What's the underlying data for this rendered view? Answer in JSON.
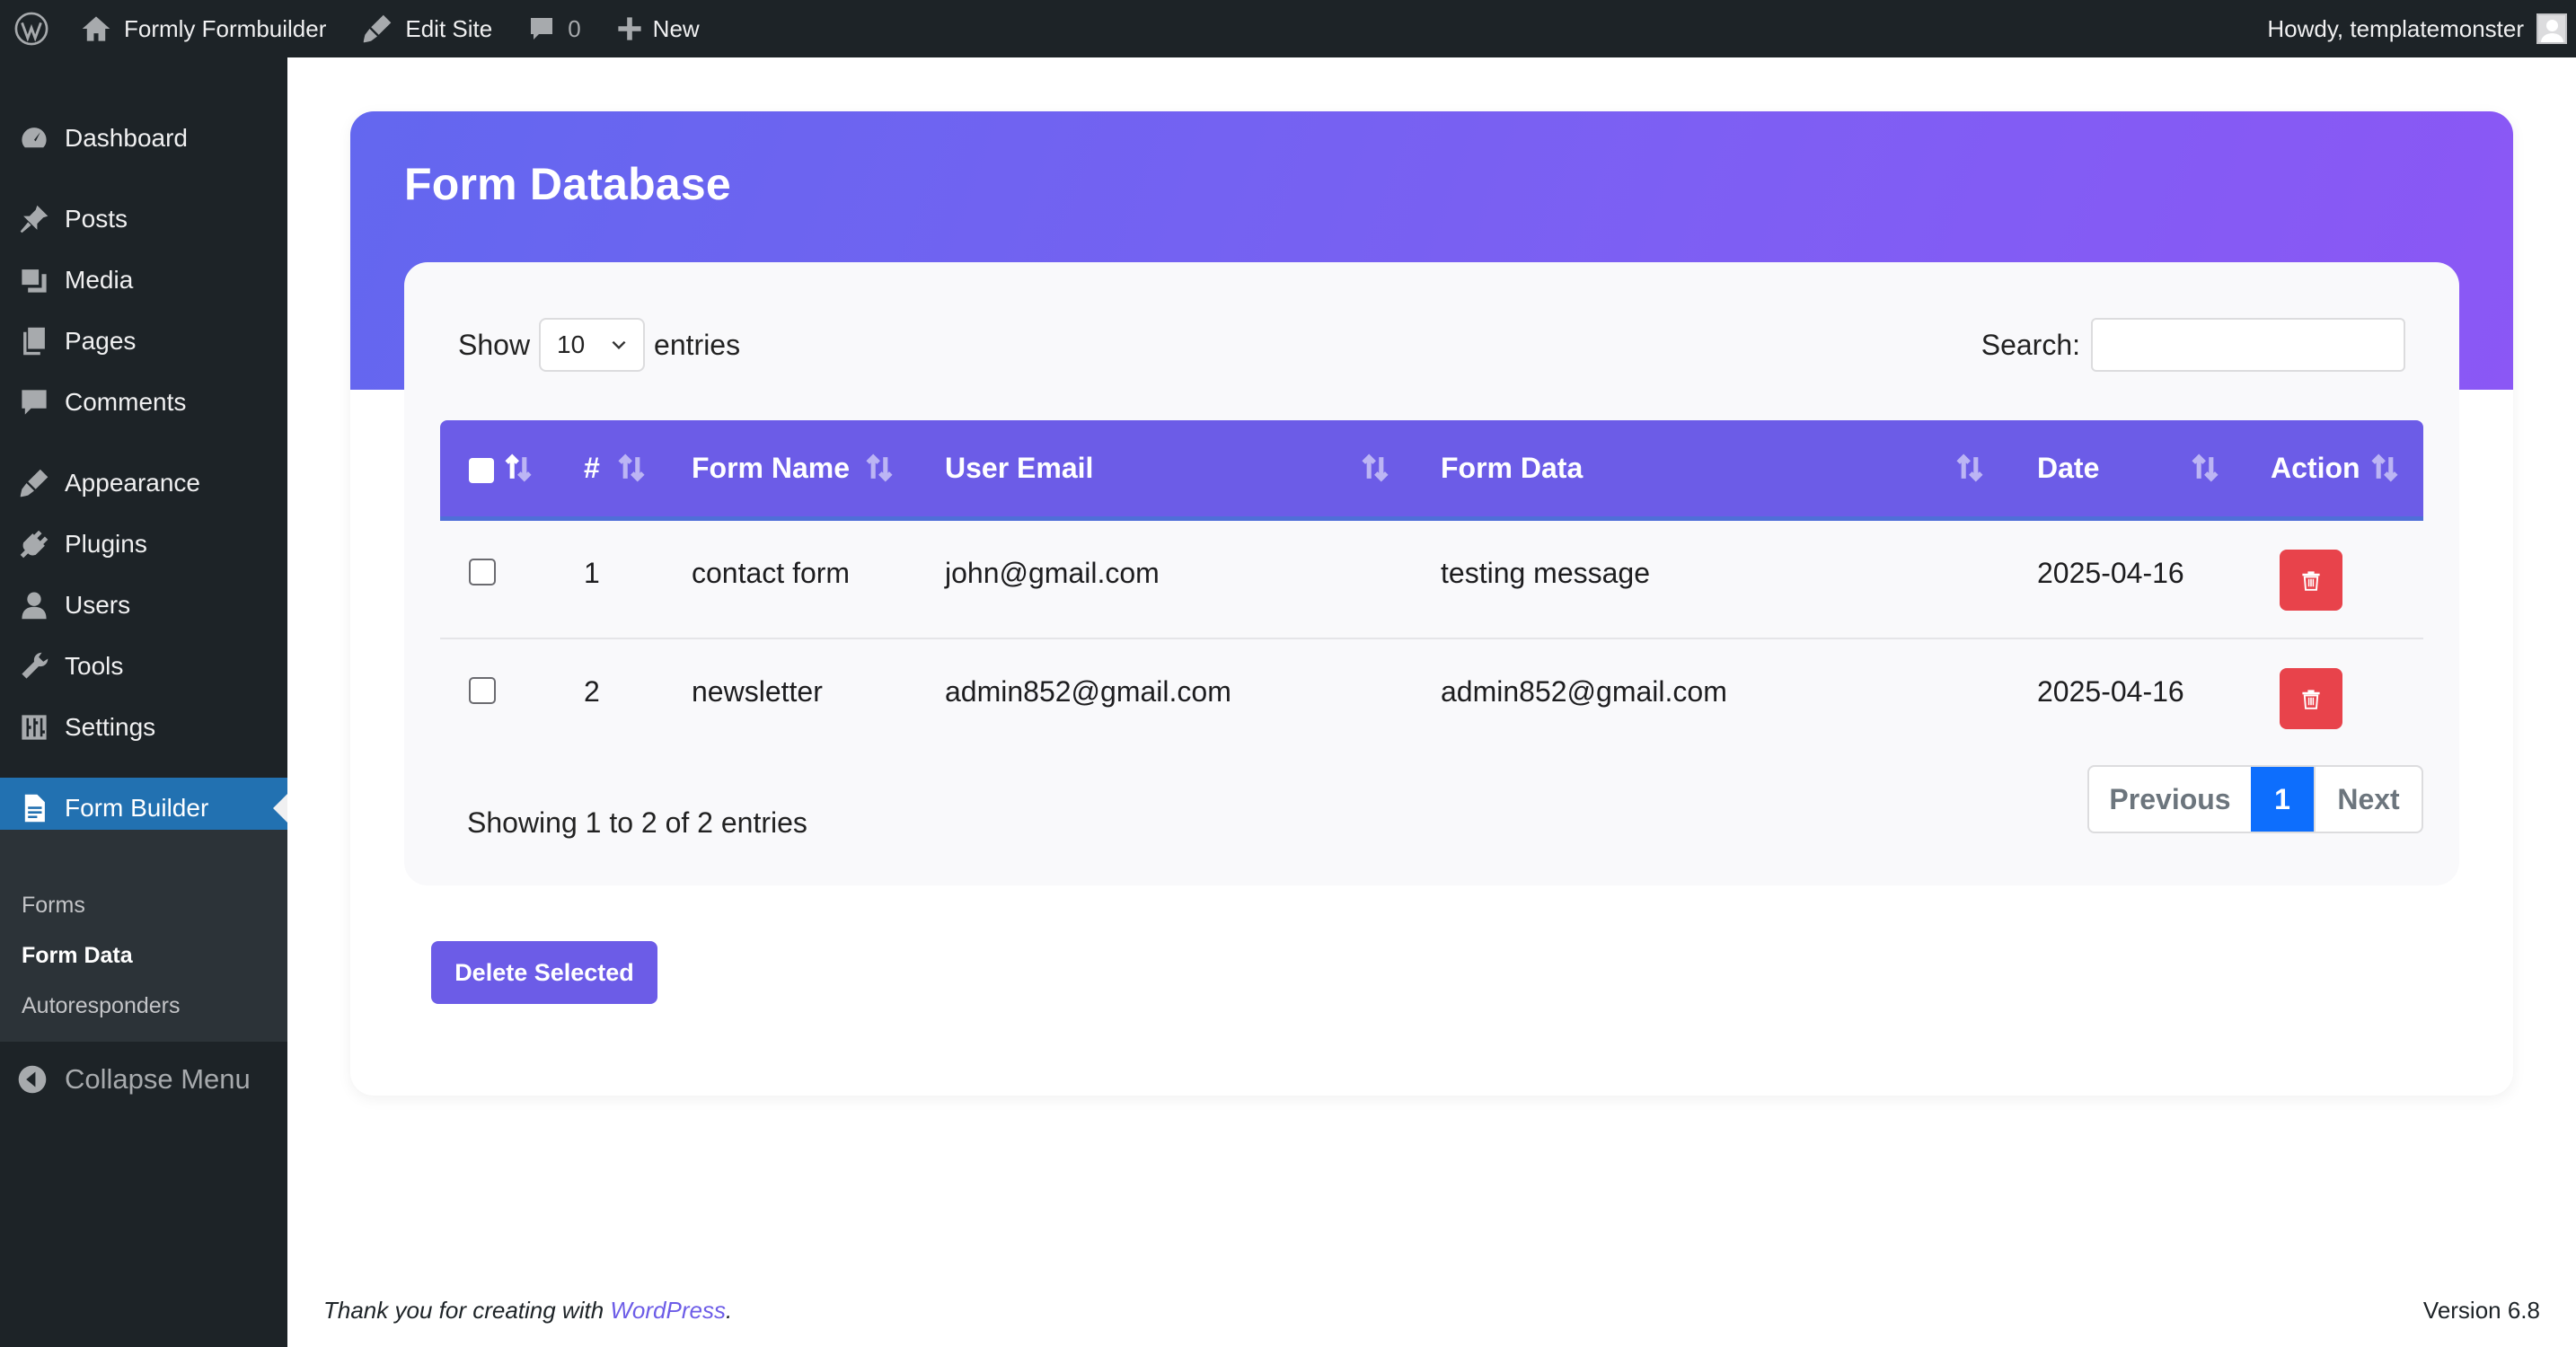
{
  "adminbar": {
    "site_name": "Formly Formbuilder",
    "edit_site": "Edit Site",
    "comments_count": "0",
    "new_label": "New",
    "greeting": "Howdy, templatemonster"
  },
  "sidebar": {
    "items": [
      {
        "label": "Dashboard",
        "icon": "dashboard-icon"
      },
      {
        "label": "Posts",
        "icon": "pin-icon"
      },
      {
        "label": "Media",
        "icon": "media-icon"
      },
      {
        "label": "Pages",
        "icon": "pages-icon"
      },
      {
        "label": "Comments",
        "icon": "comment-icon"
      },
      {
        "label": "Appearance",
        "icon": "brush-icon"
      },
      {
        "label": "Plugins",
        "icon": "plug-icon"
      },
      {
        "label": "Users",
        "icon": "user-icon"
      },
      {
        "label": "Tools",
        "icon": "wrench-icon"
      },
      {
        "label": "Settings",
        "icon": "sliders-icon"
      },
      {
        "label": "Form Builder",
        "icon": "document-icon"
      }
    ],
    "submenu": [
      "Forms",
      "Form Data",
      "Autoresponders"
    ],
    "collapse_label": "Collapse Menu"
  },
  "page": {
    "title": "Form Database",
    "show_label": "Show",
    "entries_value": "10",
    "entries_label": "entries",
    "search_label": "Search:",
    "search_value": ""
  },
  "table": {
    "headers": [
      "#",
      "Form Name",
      "User Email",
      "Form Data",
      "Date",
      "Action"
    ],
    "rows": [
      {
        "id": "1",
        "form_name": "contact form",
        "email": "john@gmail.com",
        "data": "testing message",
        "date": "2025-04-16"
      },
      {
        "id": "2",
        "form_name": "newsletter",
        "email": "admin852@gmail.com",
        "data": "admin852@gmail.com",
        "date": "2025-04-16"
      }
    ]
  },
  "footer_info": {
    "showing": "Showing 1 to 2 of 2 entries",
    "prev": "Previous",
    "page": "1",
    "next": "Next"
  },
  "bulk": {
    "delete_selected": "Delete Selected"
  },
  "footer": {
    "thanks_prefix": "Thank you for creating with ",
    "wp_link": "WordPress",
    "thanks_suffix": ".",
    "version": "Version 6.8"
  },
  "colors": {
    "accent": "#6c5ce7",
    "delete": "#e8434b",
    "page_active": "#0d6efd",
    "admin_dark": "#1d2327",
    "wp_active": "#2271b1"
  }
}
